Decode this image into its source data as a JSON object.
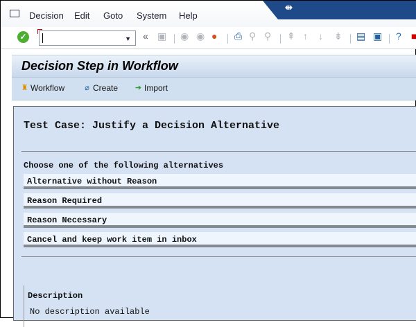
{
  "menubar": {
    "items": [
      "Decision",
      "Edit",
      "Goto",
      "System",
      "Help"
    ]
  },
  "toolbar": {
    "command_field": "",
    "icons": [
      "enter-icon",
      "save-icon",
      "back-icon",
      "exit-icon",
      "cancel-icon",
      "print-icon",
      "find-icon",
      "find-next-icon",
      "first-page-icon",
      "previous-page-icon",
      "next-page-icon",
      "last-page-icon",
      "create-session-icon",
      "shortcut-icon",
      "help-icon"
    ]
  },
  "title": "Decision Step in Workflow",
  "appbar": {
    "buttons": [
      "Workflow",
      "Create",
      "Import"
    ]
  },
  "content": {
    "heading": "Test Case: Justify a Decision Alternative",
    "prompt": "Choose one of the following alternatives",
    "alternatives": [
      "Alternative without Reason",
      "Reason Required",
      "Reason Necessary",
      "Cancel and keep work item in inbox"
    ],
    "description_label": "Description",
    "description_text": "No description available"
  }
}
